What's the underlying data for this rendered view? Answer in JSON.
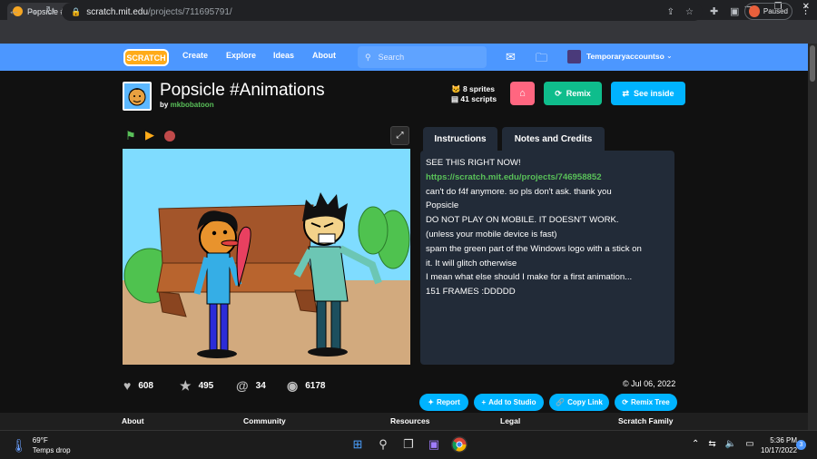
{
  "browser": {
    "tab_title": "Popsicle #Animations on Scratch",
    "tab_close": "✕",
    "new_tab": "+",
    "url_host": "scratch.mit.edu",
    "url_path": "/projects/711695791/",
    "profile_status": "Paused"
  },
  "header": {
    "logo": "SCRATCH",
    "nav": [
      "Create",
      "Explore",
      "Ideas",
      "About"
    ],
    "search_placeholder": "Search",
    "username": "Temporaryaccountso"
  },
  "project": {
    "title": "Popsicle #Animations",
    "by_prefix": "by",
    "author": "mkbobatoon",
    "sprites": "8 sprites",
    "scripts": "41 scripts",
    "remix_label": "Remix",
    "see_inside_label": "See inside"
  },
  "tabs": {
    "instructions": "Instructions",
    "notes": "Notes and Credits"
  },
  "instructions_lines": [
    "SEE THIS RIGHT NOW!",
    "https://scratch.mit.edu/projects/746958852",
    "can't do f4f anymore. so pls don't ask. thank you",
    "Popsicle",
    "DO NOT PLAY ON MOBILE. IT DOESN'T WORK.",
    "(unless your mobile device is fast)",
    "spam the green part of the Windows logo with a stick on",
    "it. It will glitch otherwise",
    "I mean what else should I make for a first animation...",
    "151 FRAMES :DDDDD"
  ],
  "stats": {
    "loves": "608",
    "favorites": "495",
    "remixes": "34",
    "views": "6178",
    "date": "Jul 06, 2022"
  },
  "actions": {
    "report": "Report",
    "add_to_studio": "Add to Studio",
    "copy_link": "Copy Link",
    "remix_tree": "Remix Tree"
  },
  "footer": [
    "About",
    "Community",
    "Resources",
    "Legal",
    "Scratch Family"
  ],
  "taskbar": {
    "temp": "69°F",
    "weather": "Temps drop",
    "time": "5:36 PM",
    "date": "10/17/2022",
    "notifications": "3"
  },
  "colors": {
    "scratch_blue": "#4c97ff",
    "remix_green": "#0fbd8c",
    "see_inside_blue": "#00b3ff",
    "panel_bg": "#222b38"
  }
}
